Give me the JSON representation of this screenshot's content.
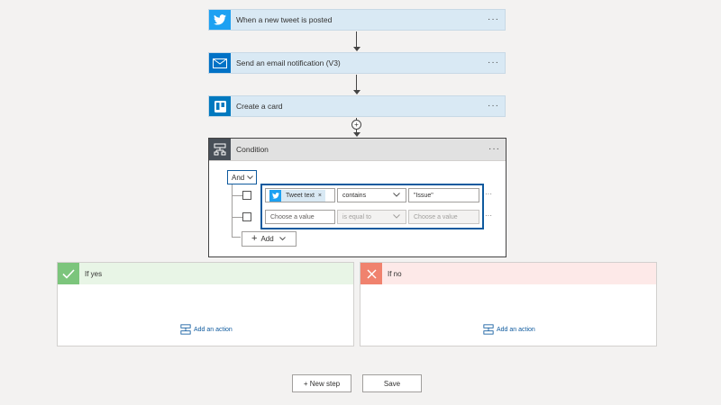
{
  "steps": {
    "tweet": {
      "title": "When a new tweet is posted",
      "icon": "twitter-icon",
      "color": "#1da1f2"
    },
    "email": {
      "title": "Send an email notification (V3)",
      "icon": "mail-icon",
      "color": "#0072c6"
    },
    "card": {
      "title": "Create a card",
      "icon": "trello-icon",
      "color": "#0079bf"
    }
  },
  "more_label": "···",
  "condition": {
    "title": "Condition",
    "group_operator": "And",
    "rows": [
      {
        "left_token": "Tweet text",
        "operator": "contains",
        "right_value": "\"Issue\""
      },
      {
        "left_placeholder": "Choose a value",
        "operator": "is equal to",
        "right_placeholder": "Choose a value"
      }
    ],
    "add_label": "Add"
  },
  "branches": {
    "yes": {
      "title": "If yes",
      "action_label": "Add an action",
      "color": "#5cb85c"
    },
    "no": {
      "title": "If no",
      "action_label": "Add an action",
      "color": "#f0826e"
    }
  },
  "footer": {
    "new_step_label": "+ New step",
    "save_label": "Save"
  }
}
